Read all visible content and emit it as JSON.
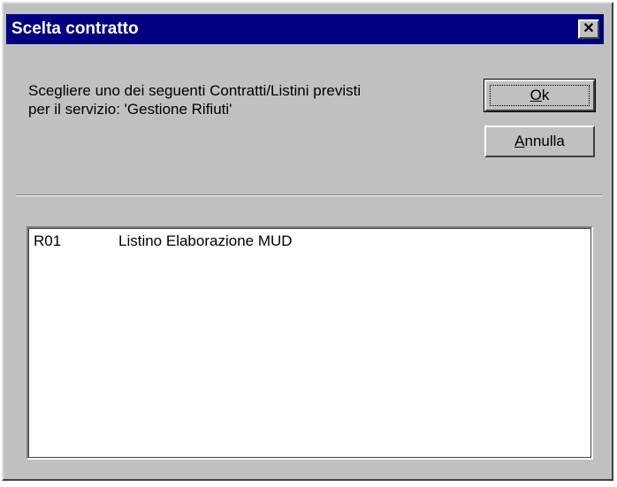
{
  "window": {
    "title": "Scelta contratto",
    "close_glyph": "✕"
  },
  "message": {
    "line1": "Scegliere uno dei seguenti Contratti/Listini previsti",
    "line2": "per il servizio: 'Gestione Rifiuti'"
  },
  "buttons": {
    "ok_label": "Ok",
    "ok_mnemonic": "O",
    "ok_rest": "k",
    "cancel_label": "Annulla",
    "cancel_mnemonic": "A",
    "cancel_rest": "nnulla"
  },
  "list": {
    "items": [
      {
        "code": "R01",
        "description": "Listino Elaborazione MUD"
      }
    ]
  },
  "colors": {
    "titlebar": "#000080",
    "dialog_face": "#c0c0c0",
    "list_background": "#ffffff"
  },
  "icons": {
    "close": "close-icon"
  }
}
